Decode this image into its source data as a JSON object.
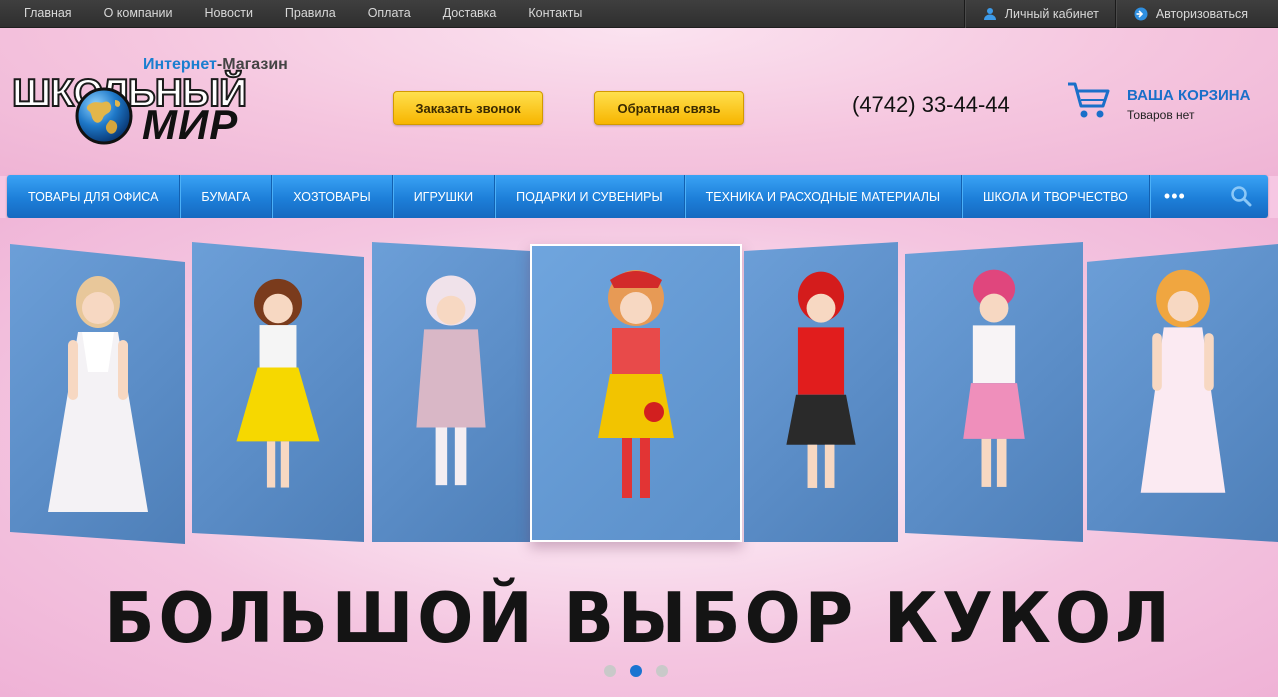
{
  "topbar": {
    "links": [
      "Главная",
      "О компании",
      "Новости",
      "Правила",
      "Оплата",
      "Доставка",
      "Контакты"
    ],
    "account_label": "Личный кабинет",
    "login_label": "Авторизоваться"
  },
  "logo": {
    "sub_part1": "Интернет",
    "sub_part2": "-Магазин",
    "line1": "ШКОЛЬНЫЙ",
    "line2": "МИР"
  },
  "header": {
    "call_button": "Заказать звонок",
    "feedback_button": "Обратная связь",
    "phone": "(4742) 33-44-44",
    "cart_title": "ВАША КОРЗИНА",
    "cart_status": "Товаров нет"
  },
  "nav": {
    "items": [
      "Товары для офиса",
      "Бумага",
      "Хозтовары",
      "Игрушки",
      "Подарки и сувениры",
      "Техника и расходные материалы",
      "Школа и творчество"
    ],
    "more": "•••"
  },
  "banner": {
    "caption": "БОЛЬШОЙ ВЫБОР КУКОЛ",
    "slide_index": 2,
    "slide_count": 3
  },
  "colors": {
    "accent_blue": "#1d7fd9",
    "button_yellow": "#f7b500",
    "topbar_dark": "#333333"
  }
}
